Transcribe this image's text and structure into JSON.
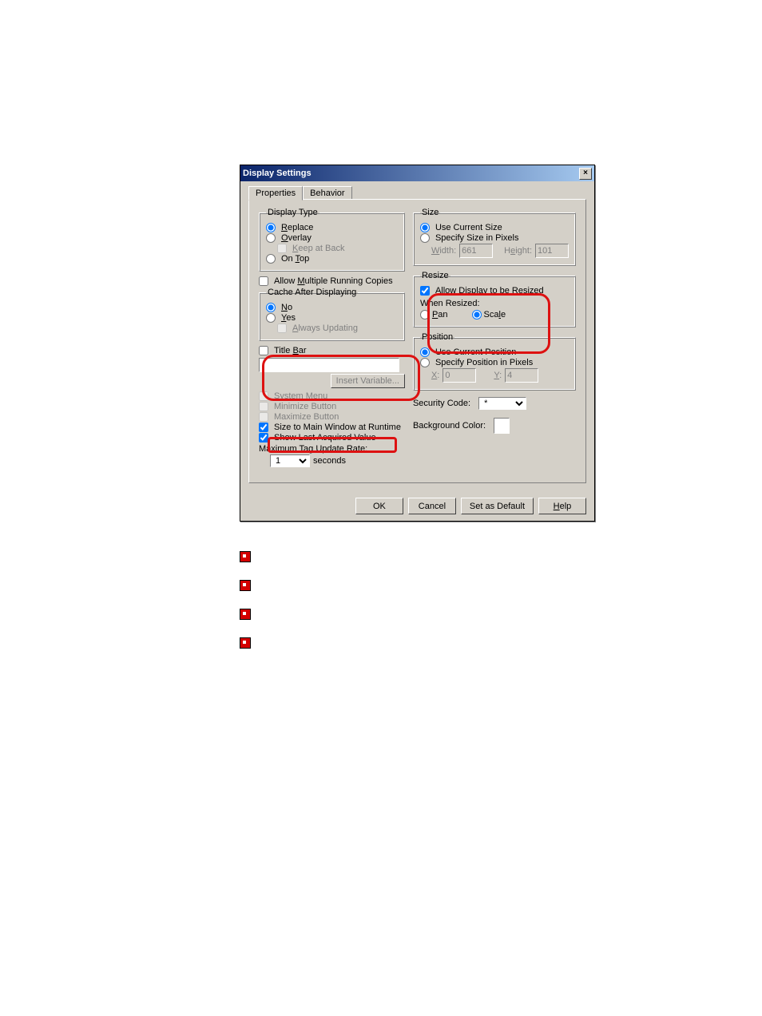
{
  "dialog": {
    "title": "Display Settings",
    "tabs": {
      "properties": "Properties",
      "behavior": "Behavior"
    },
    "display_type": {
      "legend": "Display Type",
      "replace": "Replace",
      "overlay": "Overlay",
      "keep_at_back": "Keep at Back",
      "on_top": "On Top"
    },
    "allow_multiple": "Allow Multiple Running Copies",
    "cache": {
      "legend": "Cache After Displaying",
      "no": "No",
      "yes": "Yes",
      "always_updating": "Always Updating"
    },
    "title_bar": "Title Bar",
    "insert_variable": "Insert Variable...",
    "system_menu": "System Menu",
    "minimize_button": "Minimize Button",
    "maximize_button": "Maximize Button",
    "size_to_main": "Size to Main Window at Runtime",
    "show_last": "Show Last Acquired Value",
    "max_update": "Maximum Tag Update Rate:",
    "update_value": "1",
    "seconds": "seconds",
    "size": {
      "legend": "Size",
      "use_current": "Use Current Size",
      "specify": "Specify Size in Pixels",
      "width_label": "Width:",
      "width_val": "661",
      "height_label": "Height:",
      "height_val": "101"
    },
    "resize": {
      "legend": "Resize",
      "allow": "Allow Display to be Resized",
      "when": "When Resized:",
      "pan": "Pan",
      "scale": "Scale"
    },
    "position": {
      "legend": "Position",
      "use_current": "Use Current Position",
      "specify": "Specify Position in Pixels",
      "x_label": "X:",
      "x_val": "0",
      "y_label": "Y:",
      "y_val": "4"
    },
    "security_code": "Security Code:",
    "security_val": "*",
    "background": "Background Color:",
    "buttons": {
      "ok": "OK",
      "cancel": "Cancel",
      "set_default": "Set as Default",
      "help": "Help"
    }
  }
}
